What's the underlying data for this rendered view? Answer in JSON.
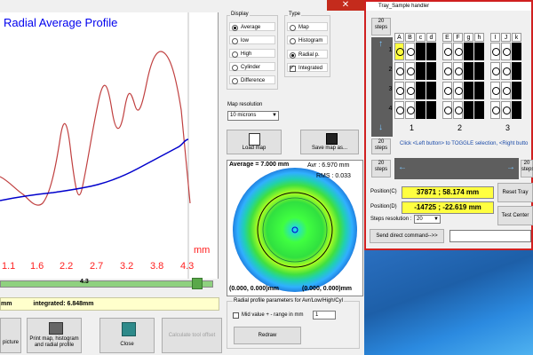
{
  "window": {
    "close_glyph": "✕"
  },
  "plot": {
    "title": "Radial Average Profile",
    "x_ticks": [
      "1.1",
      "1.6",
      "2.2",
      "2.7",
      "3.2",
      "3.8",
      "4.3"
    ],
    "x_unit": "mm",
    "slider_value": "4.3",
    "integrated_text": "integrated: 6.848mm",
    "left_fragment": "mm",
    "line_colors": {
      "red": "#c04040",
      "blue": "#0000cc"
    }
  },
  "display_group": {
    "label": "Display",
    "options": [
      "Average",
      "low",
      "High",
      "Cylinder",
      "Difference"
    ],
    "selected": "Average"
  },
  "type_group": {
    "label": "Type",
    "options": [
      "Map",
      "Histogram",
      "Radial p."
    ],
    "selected": "Radial p.",
    "integrated_label": "Integrated",
    "integrated_checked": true
  },
  "map_resolution": {
    "label": "Map resolution",
    "value": "10 microns"
  },
  "buttons": {
    "load_map": "Load map",
    "save_map": "Save map as...",
    "picture": "picture",
    "print": "Print map, histogram and radial profile",
    "close": "Close",
    "calc_offset": "Calculate tool offset",
    "redraw": "Redraw"
  },
  "map": {
    "average": "Average = 7.000 mm",
    "avr": "Avr : 6.970 mm",
    "rms": "RMS : 0.033",
    "bottom_left": "(0.000, 0.000)mm",
    "bottom_right": "(0.000, 0.000)mm"
  },
  "radial_params": {
    "label": "Radial profile parameters for Avr/Low/High/Cyl",
    "mid_label": "Mid value + - range in mm",
    "mid_value": "1",
    "mid_checked": false
  },
  "tray": {
    "title": "Tray_Sample handler",
    "steps_label": "20 steps",
    "columns": [
      "A",
      "B",
      "c",
      "d",
      "E",
      "F",
      "g",
      "h",
      "I",
      "J",
      "k"
    ],
    "rows": [
      "1",
      "2",
      "3",
      "4"
    ],
    "groups": [
      "1",
      "2",
      "3"
    ],
    "instruction": "Click <Left button> to TOGGLE selection, <Right butto",
    "position_c_label": "Position(C)",
    "position_c_value": "37871 ; 58.174 mm",
    "position_d_label": "Position(D)",
    "position_d_value": "-14725 ; -22.619 mm",
    "steps_resolution_label": "Steps resolution :",
    "steps_resolution_value": "20",
    "reset_button": "Reset Tray",
    "test_center_button": "Test Center",
    "send_command_button": "Send direct command-->>"
  }
}
